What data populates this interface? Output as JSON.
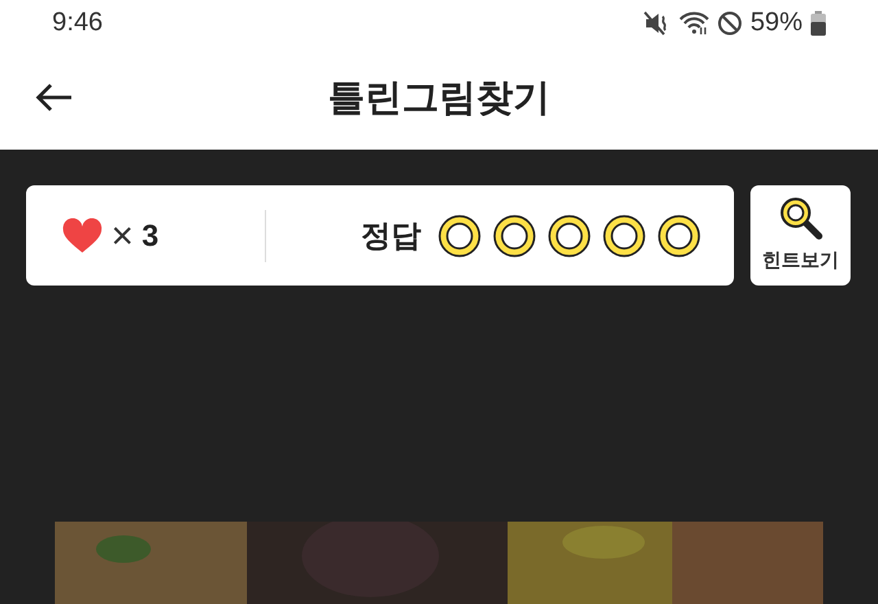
{
  "status_bar": {
    "time": "9:46",
    "battery": "59%"
  },
  "header": {
    "title": "틀린그림찾기"
  },
  "score": {
    "lives": "3",
    "times": "×",
    "answer_label": "정답",
    "answers": [
      {
        "found": false
      },
      {
        "found": false
      },
      {
        "found": false
      },
      {
        "found": false
      },
      {
        "found": false
      }
    ]
  },
  "hint_button": {
    "label": "힌트보기"
  }
}
